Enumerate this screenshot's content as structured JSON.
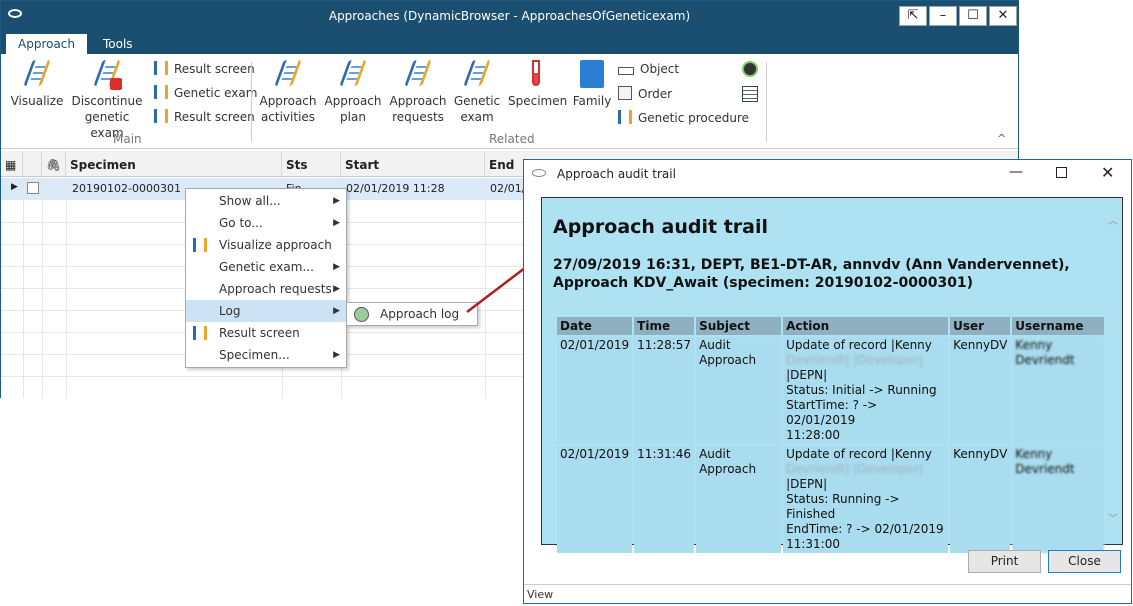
{
  "main_window": {
    "title": "Approaches (DynamicBrowser - ApproachesOfGeneticexam)",
    "tabs": [
      "Approach",
      "Tools"
    ],
    "ribbon": {
      "main_group": "Main",
      "related_group": "Related",
      "visualize": "Visualize",
      "discontinue_l1": "Discontinue",
      "discontinue_l2": "genetic exam",
      "result_screen_1": "Result screen",
      "genetic_exam": "Genetic exam",
      "result_screen_2": "Result screen",
      "approach_activities_l1": "Approach",
      "approach_activities_l2": "activities",
      "approach_plan_l1": "Approach",
      "approach_plan_l2": "plan",
      "approach_requests_l1": "Approach",
      "approach_requests_l2": "requests",
      "genetic_exam_big_l1": "Genetic",
      "genetic_exam_big_l2": "exam",
      "specimen": "Specimen",
      "family": "Family",
      "object": "Object",
      "order": "Order",
      "genetic_procedure": "Genetic procedure"
    },
    "grid": {
      "columns": {
        "specimen": "Specimen",
        "sts": "Sts",
        "start": "Start",
        "end": "End"
      },
      "row": {
        "specimen": "20190102-0000301",
        "sts": "Fin",
        "start": "02/01/2019 11:28",
        "end": "02/01/"
      }
    }
  },
  "context_menu": {
    "items": [
      "Show all...",
      "Go to...",
      "Visualize approach",
      "Genetic exam...",
      "Approach requests",
      "Log",
      "Result screen",
      "Specimen..."
    ],
    "submenu_item": "Approach log"
  },
  "dialog": {
    "title": "Approach audit trail",
    "heading": "Approach audit trail",
    "subheading": "27/09/2019 16:31, DEPT, BE1-DT-AR, annvdv (Ann Vandervennet), Approach KDV_Await (specimen: 20190102-0000301)",
    "table": {
      "headers": [
        "Date",
        "Time",
        "Subject",
        "Action",
        "User",
        "Username"
      ],
      "rows": [
        {
          "date": "02/01/2019",
          "time": "11:28:57",
          "subject": "Audit Approach",
          "action": [
            "Update of record |Kenny",
            "Devriendt| |Developer|",
            "|DEPN|",
            "Status: Initial -> Running",
            "StartTime: ? -> 02/01/2019",
            "11:28:00"
          ],
          "user": "KennyDV",
          "username": "Kenny Devriendt"
        },
        {
          "date": "02/01/2019",
          "time": "11:31:46",
          "subject": "Audit Approach",
          "action": [
            "Update of record |Kenny",
            "Devriendt| |Developer|",
            "|DEPN|",
            "Status: Running -> Finished",
            "EndTime: ? -> 02/01/2019",
            "11:31:00"
          ],
          "user": "KennyDV",
          "username": "Kenny Devriendt"
        }
      ]
    },
    "print_button": "Print",
    "close_button": "Close",
    "status": "View"
  }
}
